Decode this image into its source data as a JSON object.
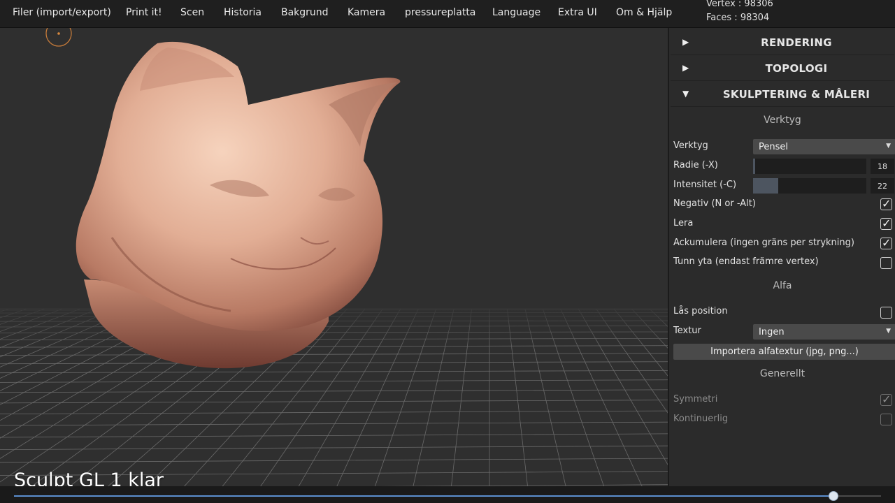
{
  "menu": {
    "items": [
      "Filer (import/export)",
      "Print it!",
      "Scen",
      "Historia",
      "Bakgrund",
      "Kamera",
      "pressureplatta",
      "Language",
      "Extra UI",
      "Om & Hjälp"
    ]
  },
  "stats": {
    "vertex": "Vertex : 98306",
    "faces": "Faces : 98304"
  },
  "viewport": {
    "caption": "Sculpt GL 1 klar",
    "model": "sculpted-cat-head"
  },
  "panel": {
    "folders": {
      "rendering": {
        "arrow": "▶",
        "title": "RENDERING"
      },
      "topologi": {
        "arrow": "▶",
        "title": "TOPOLOGI"
      },
      "skulptering": {
        "arrow": "▼",
        "title": "SKULPTERING & MÅLERI"
      }
    },
    "sections": {
      "verktyg": "Verktyg",
      "alfa": "Alfa",
      "generellt": "Generellt"
    },
    "tool": {
      "label": "Verktyg",
      "value": "Pensel"
    },
    "radius": {
      "label": "Radie (-X)",
      "value": "18",
      "fraction": 0.02
    },
    "intensity": {
      "label": "Intensitet (-C)",
      "value": "22",
      "fraction": 0.22
    },
    "toggles": {
      "negativ": {
        "label": "Negativ (N or -Alt)",
        "checked": true
      },
      "lera": {
        "label": "Lera",
        "checked": true
      },
      "ackumulera": {
        "label": "Ackumulera (ingen gräns per strykning)",
        "checked": true
      },
      "tunn_yta": {
        "label": "Tunn yta (endast främre vertex)",
        "checked": false
      },
      "las_position": {
        "label": "Lås position",
        "checked": false
      },
      "symmetri": {
        "label": "Symmetri",
        "checked": true
      },
      "kontinuerlig": {
        "label": "Kontinuerlig",
        "checked": false
      }
    },
    "texture": {
      "label": "Textur",
      "value": "Ingen"
    },
    "import_button": "Importera alfatextur (jpg, png...)"
  },
  "playback": {
    "progress": 0.945
  }
}
